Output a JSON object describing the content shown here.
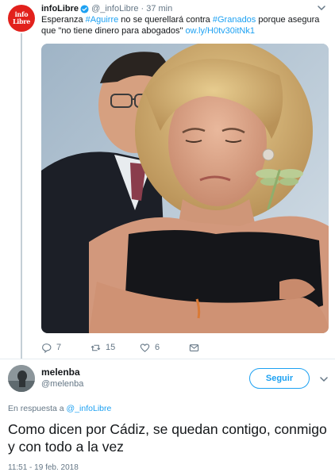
{
  "parent_tweet": {
    "avatar_text_1": "info",
    "avatar_text_2": "Libre",
    "display_name": "infoLibre",
    "handle": "@_infoLibre",
    "dot": "·",
    "time": "37 min",
    "text": {
      "p1": "Esperanza ",
      "hashtag1": "#Aguirre",
      "p2": " no se querellará contra ",
      "hashtag2": "#Granados",
      "p3": " porque asegura que \"no tiene dinero para abogados\" ",
      "link": "ow.ly/H0tv30itNk1"
    },
    "actions": {
      "replies": "7",
      "retweets": "15",
      "likes": "6"
    }
  },
  "main_tweet": {
    "display_name": "melenba",
    "handle": "@melenba",
    "follow_label": "Seguir",
    "reply_prefix": "En respuesta a ",
    "reply_handle": "@_infoLibre",
    "text": "Como dicen por Cádiz, se quedan contigo, conmigo y con todo a la vez",
    "timestamp": "11:51 - 19 feb. 2018"
  },
  "colors": {
    "accent": "#1da1f2",
    "secondary_text": "#657786",
    "avatar_brand": "#e2211c"
  },
  "icons": [
    "verified-badge-icon",
    "chevron-down-icon",
    "reply-icon",
    "retweet-icon",
    "like-icon",
    "direct-message-icon"
  ]
}
